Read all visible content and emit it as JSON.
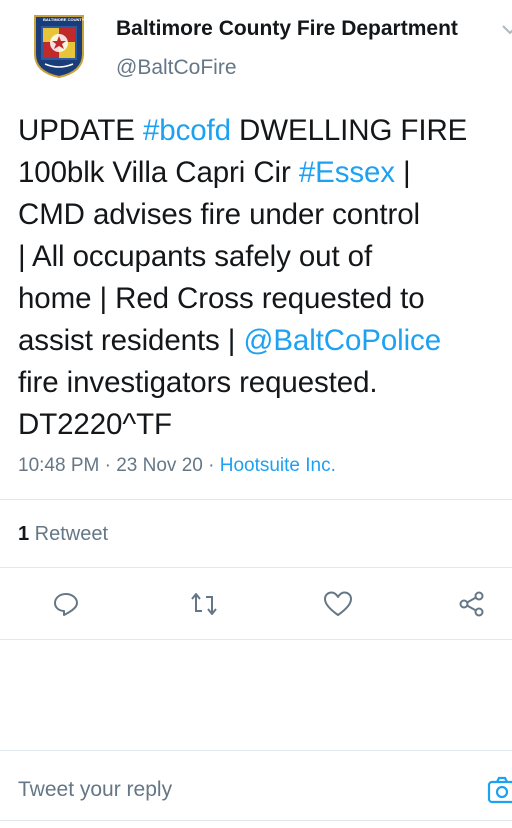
{
  "account": {
    "name": "Baltimore County Fire Department",
    "handle": "@BaltCoFire",
    "avatar_text": "BALTIMORE COUNTY"
  },
  "tweet": {
    "lines": [
      [
        {
          "t": "UPDATE ",
          "link": false
        },
        {
          "t": "#bcofd",
          "link": true
        },
        {
          "t": " DWELLING FIRE",
          "link": false
        }
      ],
      [
        {
          "t": "100blk Villa Capri Cir ",
          "link": false
        },
        {
          "t": "#Essex",
          "link": true
        },
        {
          "t": " |",
          "link": false
        }
      ],
      [
        {
          "t": "CMD advises fire under control",
          "link": false
        }
      ],
      [
        {
          "t": "| All occupants safely out of",
          "link": false
        }
      ],
      [
        {
          "t": "home | Red Cross requested to",
          "link": false
        }
      ],
      [
        {
          "t": "assist residents | ",
          "link": false
        },
        {
          "t": "@BaltCoPolice",
          "link": true
        }
      ],
      [
        {
          "t": "fire investigators requested.",
          "link": false
        }
      ],
      [
        {
          "t": "DT2220^TF",
          "link": false
        }
      ]
    ],
    "time": "10:48 PM",
    "date": "23 Nov 20",
    "separator": " · ",
    "source": "Hootsuite Inc."
  },
  "stats": {
    "retweet_count": "1",
    "retweet_label": " Retweet"
  },
  "actions": {
    "reply_icon": "reply-icon",
    "retweet_icon": "retweet-icon",
    "like_icon": "heart-icon",
    "share_icon": "share-icon"
  },
  "reply": {
    "placeholder": "Tweet your reply"
  },
  "colors": {
    "link": "#1da1f2",
    "text": "#14171a",
    "secondary": "#657786",
    "divider": "#e1e8ed"
  }
}
